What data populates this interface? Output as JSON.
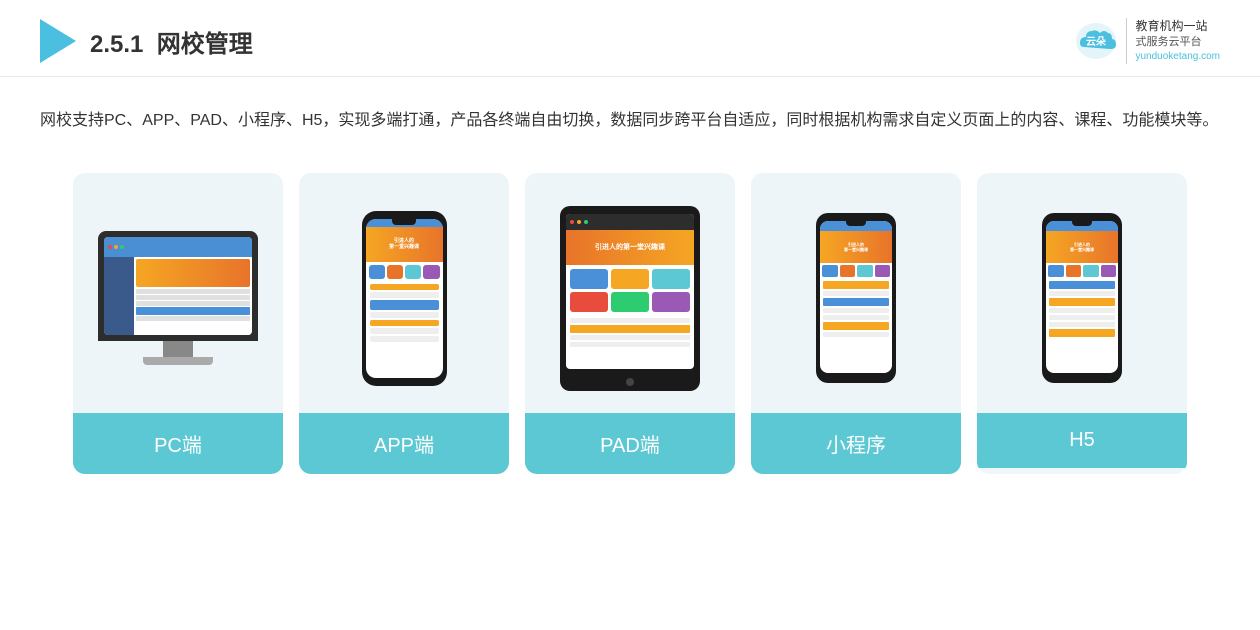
{
  "header": {
    "section_number": "2.5.1",
    "title_plain": "",
    "title_bold": "网校管理",
    "logo_alt": "云朵课堂",
    "brand_line1": "教育机构一站",
    "brand_line2": "式服务云平台",
    "brand_domain": "yunduoketang.com"
  },
  "description": {
    "text": "网校支持PC、APP、PAD、小程序、H5，实现多端打通，产品各终端自由切换，数据同步跨平台自适应，同时根据机构需求自定义页面上的内容、课程、功能模块等。"
  },
  "cards": [
    {
      "id": "pc",
      "label": "PC端",
      "device_type": "pc"
    },
    {
      "id": "app",
      "label": "APP端",
      "device_type": "phone"
    },
    {
      "id": "pad",
      "label": "PAD端",
      "device_type": "tablet"
    },
    {
      "id": "miniapp",
      "label": "小程序",
      "device_type": "phone-small"
    },
    {
      "id": "h5",
      "label": "H5",
      "device_type": "phone-small"
    }
  ],
  "colors": {
    "accent": "#5CC8D4",
    "header_blue": "#4a90d9",
    "triangle": "#4ABFDF"
  }
}
